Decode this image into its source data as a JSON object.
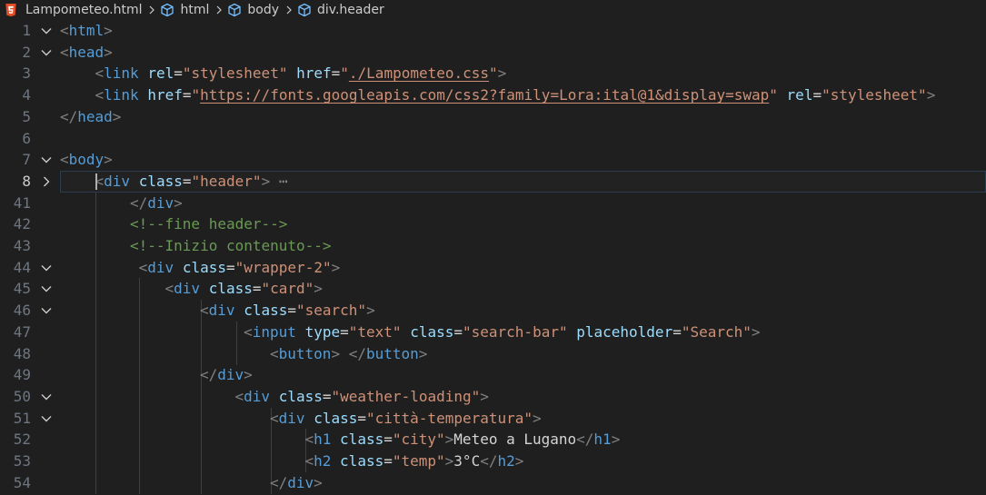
{
  "breadcrumb": {
    "file": "Lampometeo.html",
    "items": [
      "html",
      "body",
      "div.header"
    ]
  },
  "icons": {
    "file_type": "html5-icon",
    "element": "cube-icon",
    "separator": "chevron-right-icon",
    "fold_open": "chevron-down-icon",
    "fold_closed": "chevron-right-icon"
  },
  "colors": {
    "background": "#1f1f1f",
    "tag": "#569cd6",
    "attribute": "#9cdcfe",
    "string": "#ce9178",
    "comment": "#6a9955",
    "text": "#d4d4d4",
    "punctuation": "#808080",
    "line_number": "#6e7681"
  },
  "editor": {
    "current_line": "8",
    "lines": [
      {
        "n": "1",
        "fold": "open",
        "indent": 0,
        "tokens": [
          [
            "br",
            "<"
          ],
          [
            "tag",
            "html"
          ],
          [
            "br",
            ">"
          ]
        ]
      },
      {
        "n": "2",
        "fold": "open",
        "indent": 0,
        "tokens": [
          [
            "br",
            "<"
          ],
          [
            "tag",
            "head"
          ],
          [
            "br",
            ">"
          ]
        ]
      },
      {
        "n": "3",
        "fold": "",
        "indent": 1,
        "tokens": [
          [
            "br",
            "<"
          ],
          [
            "tag",
            "link"
          ],
          [
            "txt",
            " "
          ],
          [
            "attr",
            "rel"
          ],
          [
            "eq",
            "="
          ],
          [
            "str",
            "\"stylesheet\""
          ],
          [
            "txt",
            " "
          ],
          [
            "attr",
            "href"
          ],
          [
            "eq",
            "="
          ],
          [
            "str",
            "\""
          ],
          [
            "link",
            "./Lampometeo.css"
          ],
          [
            "str",
            "\""
          ],
          [
            "br",
            ">"
          ]
        ]
      },
      {
        "n": "4",
        "fold": "",
        "indent": 1,
        "tokens": [
          [
            "br",
            "<"
          ],
          [
            "tag",
            "link"
          ],
          [
            "txt",
            " "
          ],
          [
            "attr",
            "href"
          ],
          [
            "eq",
            "="
          ],
          [
            "str",
            "\""
          ],
          [
            "link",
            "https://fonts.googleapis.com/css2?family=Lora:ital@1&display=swap"
          ],
          [
            "str",
            "\""
          ],
          [
            "txt",
            " "
          ],
          [
            "attr",
            "rel"
          ],
          [
            "eq",
            "="
          ],
          [
            "str",
            "\"stylesheet\""
          ],
          [
            "br",
            ">"
          ]
        ]
      },
      {
        "n": "5",
        "fold": "",
        "indent": 0,
        "tokens": [
          [
            "br",
            "</"
          ],
          [
            "tag",
            "head"
          ],
          [
            "br",
            ">"
          ]
        ]
      },
      {
        "n": "6",
        "fold": "",
        "indent": 0,
        "tokens": []
      },
      {
        "n": "7",
        "fold": "open",
        "indent": 0,
        "tokens": [
          [
            "br",
            "<"
          ],
          [
            "tag",
            "body"
          ],
          [
            "br",
            ">"
          ]
        ]
      },
      {
        "n": "8",
        "fold": "closed",
        "indent": 1,
        "tokens": [
          [
            "br",
            "<"
          ],
          [
            "tag",
            "div"
          ],
          [
            "txt",
            " "
          ],
          [
            "attr",
            "class"
          ],
          [
            "eq",
            "="
          ],
          [
            "str",
            "\"header\""
          ],
          [
            "br",
            ">"
          ],
          [
            "ellip",
            " ⋯"
          ]
        ]
      },
      {
        "n": "41",
        "fold": "",
        "indent": 2,
        "tokens": [
          [
            "br",
            "</"
          ],
          [
            "tag",
            "div"
          ],
          [
            "br",
            ">"
          ]
        ]
      },
      {
        "n": "42",
        "fold": "",
        "indent": 2,
        "tokens": [
          [
            "com",
            "<!--fine header-->"
          ]
        ]
      },
      {
        "n": "43",
        "fold": "",
        "indent": 2,
        "tokens": [
          [
            "com",
            "<!--Inizio contenuto-->"
          ]
        ]
      },
      {
        "n": "44",
        "fold": "open",
        "indent": 2.25,
        "tokens": [
          [
            "br",
            "<"
          ],
          [
            "tag",
            "div"
          ],
          [
            "txt",
            " "
          ],
          [
            "attr",
            "class"
          ],
          [
            "eq",
            "="
          ],
          [
            "str",
            "\"wrapper-2\""
          ],
          [
            "br",
            ">"
          ]
        ]
      },
      {
        "n": "45",
        "fold": "open",
        "indent": 3,
        "tokens": [
          [
            "br",
            "<"
          ],
          [
            "tag",
            "div"
          ],
          [
            "txt",
            " "
          ],
          [
            "attr",
            "class"
          ],
          [
            "eq",
            "="
          ],
          [
            "str",
            "\"card\""
          ],
          [
            "br",
            ">"
          ]
        ]
      },
      {
        "n": "46",
        "fold": "open",
        "indent": 4,
        "tokens": [
          [
            "br",
            "<"
          ],
          [
            "tag",
            "div"
          ],
          [
            "txt",
            " "
          ],
          [
            "attr",
            "class"
          ],
          [
            "eq",
            "="
          ],
          [
            "str",
            "\"search\""
          ],
          [
            "br",
            ">"
          ]
        ]
      },
      {
        "n": "47",
        "fold": "",
        "indent": 5.25,
        "tokens": [
          [
            "br",
            "<"
          ],
          [
            "tag",
            "input"
          ],
          [
            "txt",
            " "
          ],
          [
            "attr",
            "type"
          ],
          [
            "eq",
            "="
          ],
          [
            "str",
            "\"text\""
          ],
          [
            "txt",
            " "
          ],
          [
            "attr",
            "class"
          ],
          [
            "eq",
            "="
          ],
          [
            "str",
            "\"search-bar\""
          ],
          [
            "txt",
            " "
          ],
          [
            "attr",
            "placeholder"
          ],
          [
            "eq",
            "="
          ],
          [
            "str",
            "\"Search\""
          ],
          [
            "br",
            ">"
          ]
        ]
      },
      {
        "n": "48",
        "fold": "",
        "indent": 6,
        "tokens": [
          [
            "br",
            "<"
          ],
          [
            "tag",
            "button"
          ],
          [
            "br",
            ">"
          ],
          [
            "txt",
            " "
          ],
          [
            "br",
            "</"
          ],
          [
            "tag",
            "button"
          ],
          [
            "br",
            ">"
          ]
        ]
      },
      {
        "n": "49",
        "fold": "",
        "indent": 4,
        "tokens": [
          [
            "br",
            "</"
          ],
          [
            "tag",
            "div"
          ],
          [
            "br",
            ">"
          ]
        ]
      },
      {
        "n": "50",
        "fold": "open",
        "indent": 5,
        "tokens": [
          [
            "br",
            "<"
          ],
          [
            "tag",
            "div"
          ],
          [
            "txt",
            " "
          ],
          [
            "attr",
            "class"
          ],
          [
            "eq",
            "="
          ],
          [
            "str",
            "\"weather-loading\""
          ],
          [
            "br",
            ">"
          ]
        ]
      },
      {
        "n": "51",
        "fold": "open",
        "indent": 6,
        "tokens": [
          [
            "br",
            "<"
          ],
          [
            "tag",
            "div"
          ],
          [
            "txt",
            " "
          ],
          [
            "attr",
            "class"
          ],
          [
            "eq",
            "="
          ],
          [
            "str",
            "\"città-temperatura\""
          ],
          [
            "br",
            ">"
          ]
        ]
      },
      {
        "n": "52",
        "fold": "",
        "indent": 7,
        "tokens": [
          [
            "br",
            "<"
          ],
          [
            "tag",
            "h1"
          ],
          [
            "txt",
            " "
          ],
          [
            "attr",
            "class"
          ],
          [
            "eq",
            "="
          ],
          [
            "str",
            "\"city\""
          ],
          [
            "br",
            ">"
          ],
          [
            "txt",
            "Meteo a Lugano"
          ],
          [
            "br",
            "</"
          ],
          [
            "tag",
            "h1"
          ],
          [
            "br",
            ">"
          ]
        ]
      },
      {
        "n": "53",
        "fold": "",
        "indent": 7,
        "tokens": [
          [
            "br",
            "<"
          ],
          [
            "tag",
            "h2"
          ],
          [
            "txt",
            " "
          ],
          [
            "attr",
            "class"
          ],
          [
            "eq",
            "="
          ],
          [
            "str",
            "\"temp\""
          ],
          [
            "br",
            ">"
          ],
          [
            "txt",
            "3°C"
          ],
          [
            "br",
            "</"
          ],
          [
            "tag",
            "h2"
          ],
          [
            "br",
            ">"
          ]
        ]
      },
      {
        "n": "54",
        "fold": "",
        "indent": 6,
        "tokens": [
          [
            "br",
            "</"
          ],
          [
            "tag",
            "div"
          ],
          [
            "br",
            ">"
          ]
        ]
      }
    ]
  }
}
